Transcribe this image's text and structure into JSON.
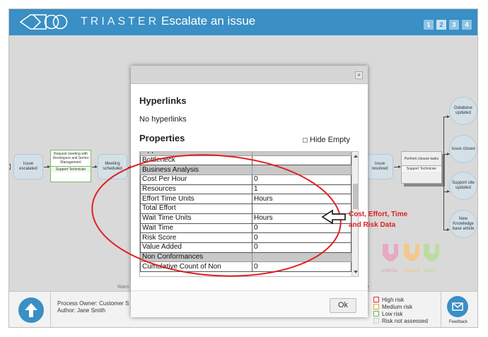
{
  "header": {
    "brand": "TRIASTER",
    "title": "Escalate an issue",
    "pages": [
      "1",
      "2",
      "3",
      "4"
    ],
    "color": "#3a8fc4"
  },
  "diagram": {
    "nodes": {
      "issue_escalated": "Issue escalated",
      "request_meeting": "Request meeting with Developers and Senior Management",
      "request_meeting_role": "Support Technician",
      "meeting_scheduled": "Meeting scheduled",
      "issue_resolved": "Issue resolved",
      "perform_closure": "Perform closure tasks",
      "perform_closure_role": "Support Technician",
      "database_updated": "Database updated",
      "issue_closed": "Issue closed",
      "support_site_updated": "Support site updated",
      "new_kb_article": "New Knowledge base article"
    },
    "warn_fragment_left": "Warn",
    "warn_fragment_right": "e"
  },
  "useful_badge": [
    "USEFUL",
    "USABLE",
    "USED"
  ],
  "modal": {
    "close_icon": "×",
    "hyperlinks_heading": "Hyperlinks",
    "no_hyperlinks": "No hyperlinks",
    "properties_heading": "Properties",
    "hide_empty_label": "Hide Empty",
    "ok_label": "Ok",
    "rows": [
      {
        "section": true,
        "key": "Opportunities",
        "value": ""
      },
      {
        "section": false,
        "key": "Bottleneck",
        "value": ""
      },
      {
        "section": true,
        "key": "Business Analysis",
        "value": ""
      },
      {
        "section": false,
        "key": "Cost Per Hour",
        "value": "0"
      },
      {
        "section": false,
        "key": "Resources",
        "value": "1"
      },
      {
        "section": false,
        "key": "Effort Time Units",
        "value": "Hours"
      },
      {
        "section": false,
        "key": "Total Effort",
        "value": ""
      },
      {
        "section": false,
        "key": "Wait Time Units",
        "value": "Hours"
      },
      {
        "section": false,
        "key": "Wait Time",
        "value": "0"
      },
      {
        "section": false,
        "key": "Risk Score",
        "value": "0"
      },
      {
        "section": false,
        "key": "Value Added",
        "value": "0"
      },
      {
        "section": true,
        "key": "Non Conformances",
        "value": ""
      },
      {
        "section": false,
        "key": "Cumulative Count of Non",
        "value": "0"
      }
    ]
  },
  "annotation": {
    "text": "Cost, Effort, Time and Risk Data",
    "color": "#e02020"
  },
  "bottombar": {
    "owner_line": "Process Owner: Customer S",
    "author_line": "Author: Jane Smith",
    "legend": [
      {
        "label": "High risk",
        "color": "#d9302c"
      },
      {
        "label": "Medium risk",
        "color": "#e8a23a"
      },
      {
        "label": "Low risk",
        "color": "#5cb85c"
      },
      {
        "label": "Risk not assessed",
        "color": "#cccccc"
      }
    ],
    "feedback_label": "Feedback"
  }
}
